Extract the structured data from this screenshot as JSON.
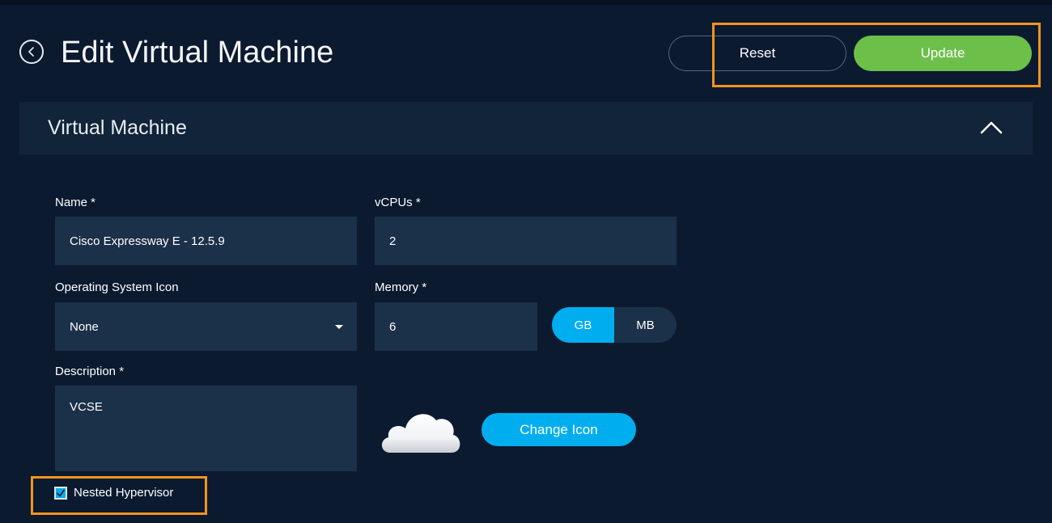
{
  "page": {
    "title": "Edit Virtual Machine",
    "reset_label": "Reset",
    "update_label": "Update"
  },
  "section": {
    "title": "Virtual Machine"
  },
  "form": {
    "name": {
      "label": "Name *",
      "value": "Cisco Expressway E - 12.5.9"
    },
    "vcpus": {
      "label": "vCPUs *",
      "value": "2"
    },
    "os_icon": {
      "label": "Operating System Icon",
      "value": "None"
    },
    "memory": {
      "label": "Memory *",
      "value": "6",
      "units": [
        "GB",
        "MB"
      ],
      "selected_unit": "GB"
    },
    "description": {
      "label": "Description *",
      "value": "VCSE"
    },
    "change_icon_label": "Change Icon",
    "nested_hypervisor": {
      "label": "Nested Hypervisor",
      "checked": true
    }
  },
  "colors": {
    "background": "#0c1a30",
    "field": "#1b3049",
    "accent": "#00aeef",
    "update": "#6cc04a",
    "highlight": "#f3941d"
  },
  "icons": {
    "back": "chevron-left-circle-icon",
    "collapse": "chevron-up-icon",
    "dropdown": "caret-down-icon",
    "cloud": "cloud-icon",
    "checkbox": "checkmark-icon"
  }
}
